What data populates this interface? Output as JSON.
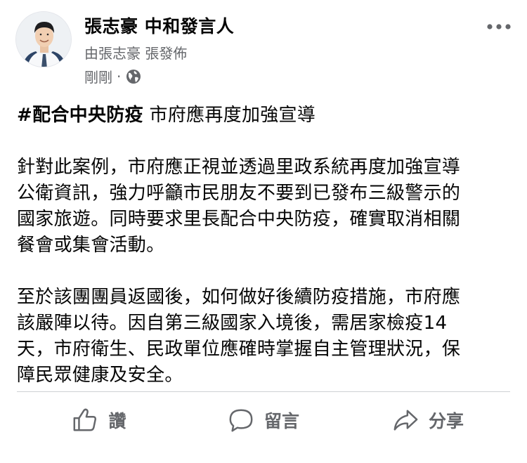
{
  "author": {
    "name": "張志豪 中和發言人",
    "posted_by": "由張志豪 張發佈"
  },
  "meta": {
    "time": "剛剛",
    "separator": "·",
    "audience_icon": "globe-icon"
  },
  "more_icon": "more-horizontal-icon",
  "post": {
    "hashtag": "#配合中央防疫",
    "headline": " 市府應再度加強宣導",
    "paragraph1_lines": [
      "針對此案例，市府應正視並透過里政系統再度加強宣導",
      "公衛資訊，強力呼籲市民朋友不要到已發布三級警示的",
      "國家旅遊。同時要求里長配合中央防疫，確實取消相關",
      "餐會或集會活動。"
    ],
    "paragraph2_lines": [
      "至於該團團員返國後，如何做好後續防疫措施，市府應",
      "該嚴陣以待。因自第三級國家入境後，需居家檢疫14",
      "天，市府衛生、民政單位應確時掌握自主管理狀況，保",
      "障民眾健康及安全。"
    ]
  },
  "actions": {
    "like": {
      "label": "讚",
      "icon": "thumbs-up-icon"
    },
    "comment": {
      "label": "留言",
      "icon": "comment-icon"
    },
    "share": {
      "label": "分享",
      "icon": "share-icon"
    }
  },
  "colors": {
    "text": "#050505",
    "secondary": "#65676b",
    "divider": "#ced0d4"
  }
}
